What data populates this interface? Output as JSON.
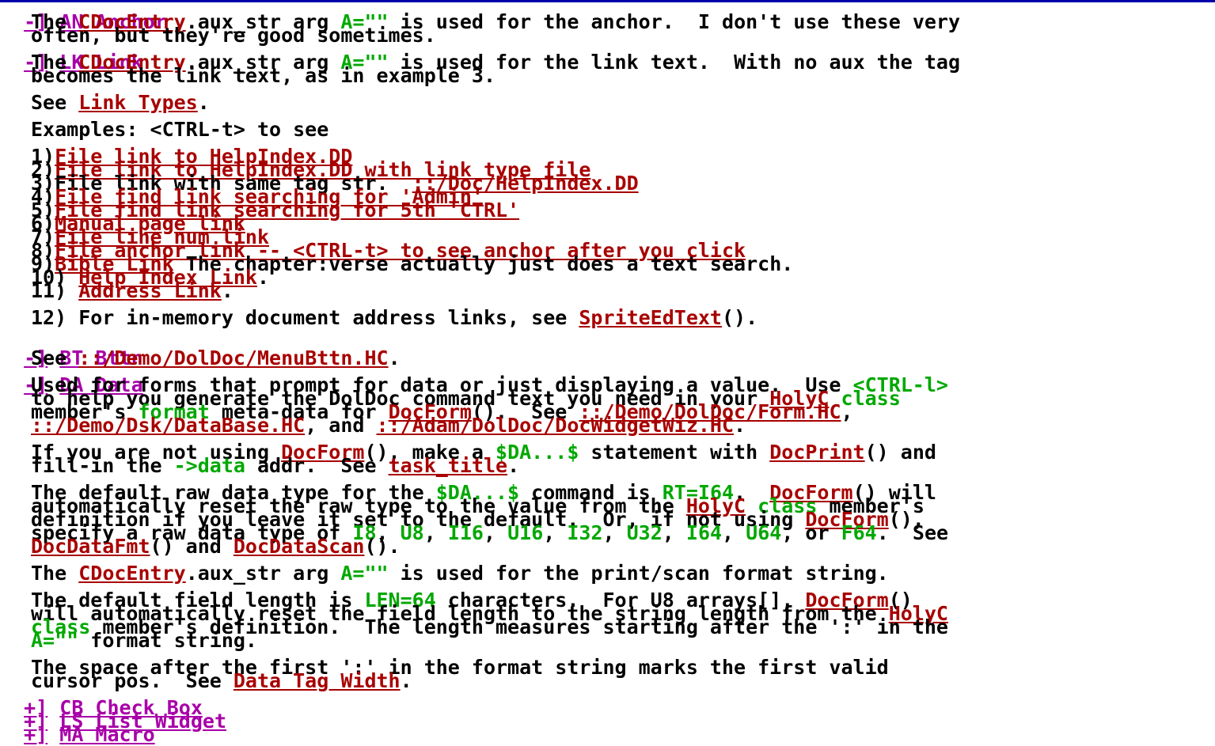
{
  "doc": {
    "sec_an": {
      "toggle": "-]",
      "title": "AN Anchor"
    },
    "an_p1": {
      "pre": "The ",
      "link": "CDocEntry",
      "mid1": ".aux_str arg ",
      "code": "A=\"\"",
      "post": " is used for the anchor.  I don't use these very"
    },
    "an_p2": "often, but they're good sometimes.",
    "sec_lk": {
      "toggle": "-]",
      "title": "LK Link"
    },
    "lk_p1": {
      "pre": "The ",
      "link": "CDocEntry",
      "mid1": ".aux_str arg ",
      "code": "A=\"\"",
      "post": " is used for the link text.  With no aux the tag"
    },
    "lk_p2": "becomes the link text, as in example 3.",
    "see_link": {
      "pre": "See ",
      "link": "Link Types",
      "post": "."
    },
    "examples": "Examples: <CTRL-t> to see",
    "ex": [
      {
        "num": "1)",
        "link": "File link to HelpIndex.DD",
        "post": ""
      },
      {
        "num": "2)",
        "link": "File link to HelpIndex.DD with link type file",
        "post": ""
      },
      {
        "num": "3)",
        "pre": "File link with same tag str.  ",
        "link": "::/Doc/HelpIndex.DD"
      },
      {
        "num": "4)",
        "link": "File find link searching for 'Admin'",
        "post": ""
      },
      {
        "num": "5)",
        "link": "File find link searching for 5th 'CTRL'",
        "post": ""
      },
      {
        "num": "6)",
        "link": "Manual page link",
        "post": ""
      },
      {
        "num": "7)",
        "link": "File line num link",
        "post": ""
      },
      {
        "num": "8)",
        "link": "File anchor link -- <CTRL-t> to see anchor after you click",
        "post": ""
      },
      {
        "num": "9)",
        "link": "Bible Link",
        "post": " The chapter:verse actually just does a text search."
      },
      {
        "num": "10) ",
        "link": "Help Index Link",
        "post": "."
      },
      {
        "num": "11) ",
        "link": "Address Link",
        "post": "."
      }
    ],
    "ex12": {
      "pre": "12) For in-memory document address links, see ",
      "link": "SpriteEdText",
      "post": "()."
    },
    "sec_bt": {
      "toggle": "-]",
      "title": "BT Bttn"
    },
    "bt_p": {
      "pre": "See ",
      "link": "::/Demo/DolDoc/MenuBttn.HC",
      "post": "."
    },
    "sec_da": {
      "toggle": "-]",
      "title": "DA Data"
    },
    "da1": {
      "pre": "Used for forms that prompt for data or just displaying a value.  Use ",
      "code": "<CTRL-l>"
    },
    "da2": {
      "pre": "to help you generate the DolDoc command text you need in your ",
      "link": "HolyC",
      "sp": " ",
      "code": "class"
    },
    "da3": {
      "pre": "member's ",
      "code": "format",
      "mid": " meta-data for ",
      "link1": "DocForm",
      "mid2": "().  See ",
      "link2": "::/Demo/DolDoc/Form.HC",
      "post": ","
    },
    "da4": {
      "link1": "::/Demo/Dsk/DataBase.HC",
      "mid": ", and ",
      "link2": "::/Adam/DolDoc/DocWidgetWiz.HC",
      "post": "."
    },
    "da5": {
      "pre": "If you are not using ",
      "link1": "DocForm",
      "mid1": "(), make a ",
      "code": "$DA...$",
      "mid2": " statement with ",
      "link2": "DocPrint",
      "post": "() and"
    },
    "da6": {
      "pre": "fill-in the ",
      "code": "->data",
      "mid": " addr.  See ",
      "link": "task_title",
      "post": "."
    },
    "da7": {
      "pre": "The default raw data type for the ",
      "code1": "$DA...$",
      "mid1": " command is ",
      "code2": "RT=I64",
      "mid2": ".  ",
      "link": "DocForm",
      "post": "() will"
    },
    "da8": {
      "pre": "automatically reset the raw type to the value from the ",
      "link": "HolyC",
      "sp": " ",
      "code": "class",
      "post": " member's"
    },
    "da9": {
      "pre": "definition if you leave it set to the default.  Or, if not using ",
      "link": "DocForm",
      "post": "(),"
    },
    "da10": {
      "pre": "specify a raw data type of ",
      "t1": "I8",
      "t2": "U8",
      "t3": "I16",
      "t4": "U16",
      "t5": "I32",
      "t6": "U32",
      "t7": "I64",
      "t8": "U64",
      "c": ", ",
      "or": ", or ",
      "t9": "F64",
      "post": ".  See"
    },
    "da11": {
      "link1": "DocDataFmt",
      "mid": "() and ",
      "link2": "DocDataScan",
      "post": "()."
    },
    "da12": {
      "pre": "The ",
      "link": "CDocEntry",
      "mid": ".aux_str arg ",
      "code": "A=\"\"",
      "post": " is used for the print/scan format string."
    },
    "da13": {
      "pre": "The default field length is ",
      "code": "LEN=64",
      "mid": " characters.  For U8 arrays[], ",
      "link": "DocForm",
      "post": "()"
    },
    "da14": {
      "pre": "will automatically reset the field length to the string length from the ",
      "link": "HolyC"
    },
    "da15": {
      "code": "class",
      "post": " member's definition.  The length measures starting after the ':' in the"
    },
    "da16": {
      "code": "A=\"\"",
      "post": " format string."
    },
    "da17": "The space after the first ':' in the format string marks the first valid",
    "da18": {
      "pre": "cursor pos.  See ",
      "link": "Data Tag Width",
      "post": "."
    },
    "sec_cb": {
      "toggle": "+]",
      "title": "CB Check Box"
    },
    "sec_ls": {
      "toggle": "+]",
      "title": "LS List Widget"
    },
    "sec_ma": {
      "toggle": "+]",
      "title": "MA Macro"
    }
  }
}
